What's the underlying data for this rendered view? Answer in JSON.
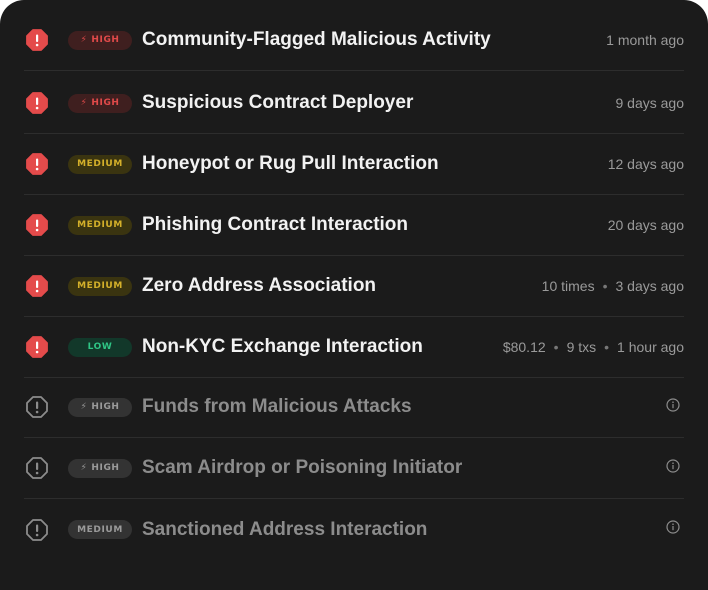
{
  "rows": [
    {
      "level": "high",
      "badge": "HIGH",
      "title": "Community-Flagged Malicious Activity",
      "meta": [
        "1 month ago"
      ],
      "active": true
    },
    {
      "level": "high",
      "badge": "HIGH",
      "title": "Suspicious Contract Deployer",
      "meta": [
        "9 days ago"
      ],
      "active": true
    },
    {
      "level": "medium",
      "badge": "MEDIUM",
      "title": "Honeypot or Rug Pull Interaction",
      "meta": [
        "12 days ago"
      ],
      "active": true
    },
    {
      "level": "medium",
      "badge": "MEDIUM",
      "title": "Phishing Contract Interaction",
      "meta": [
        "20 days ago"
      ],
      "active": true
    },
    {
      "level": "medium",
      "badge": "MEDIUM",
      "title": "Zero Address Association",
      "meta": [
        "10 times",
        "3 days ago"
      ],
      "active": true
    },
    {
      "level": "low",
      "badge": "LOW",
      "title": "Non-KYC Exchange Interaction",
      "meta": [
        "$80.12",
        "9 txs",
        "1 hour ago"
      ],
      "active": true
    },
    {
      "level": "high",
      "badge": "HIGH",
      "title": "Funds from Malicious Attacks",
      "meta": [],
      "active": false
    },
    {
      "level": "high",
      "badge": "HIGH",
      "title": "Scam Airdrop or Poisoning Initiator",
      "meta": [],
      "active": false
    },
    {
      "level": "medium",
      "badge": "MEDIUM",
      "title": "Sanctioned Address Interaction",
      "meta": [],
      "active": false
    }
  ],
  "colors": {
    "alert_red": "#e44b4b",
    "inactive_icon": "#8c8c8c"
  },
  "icons": {
    "active": "alert-octagon-icon",
    "inactive": "alert-octagon-outline-icon",
    "info": "info-icon",
    "bolt": "lightning-icon"
  }
}
